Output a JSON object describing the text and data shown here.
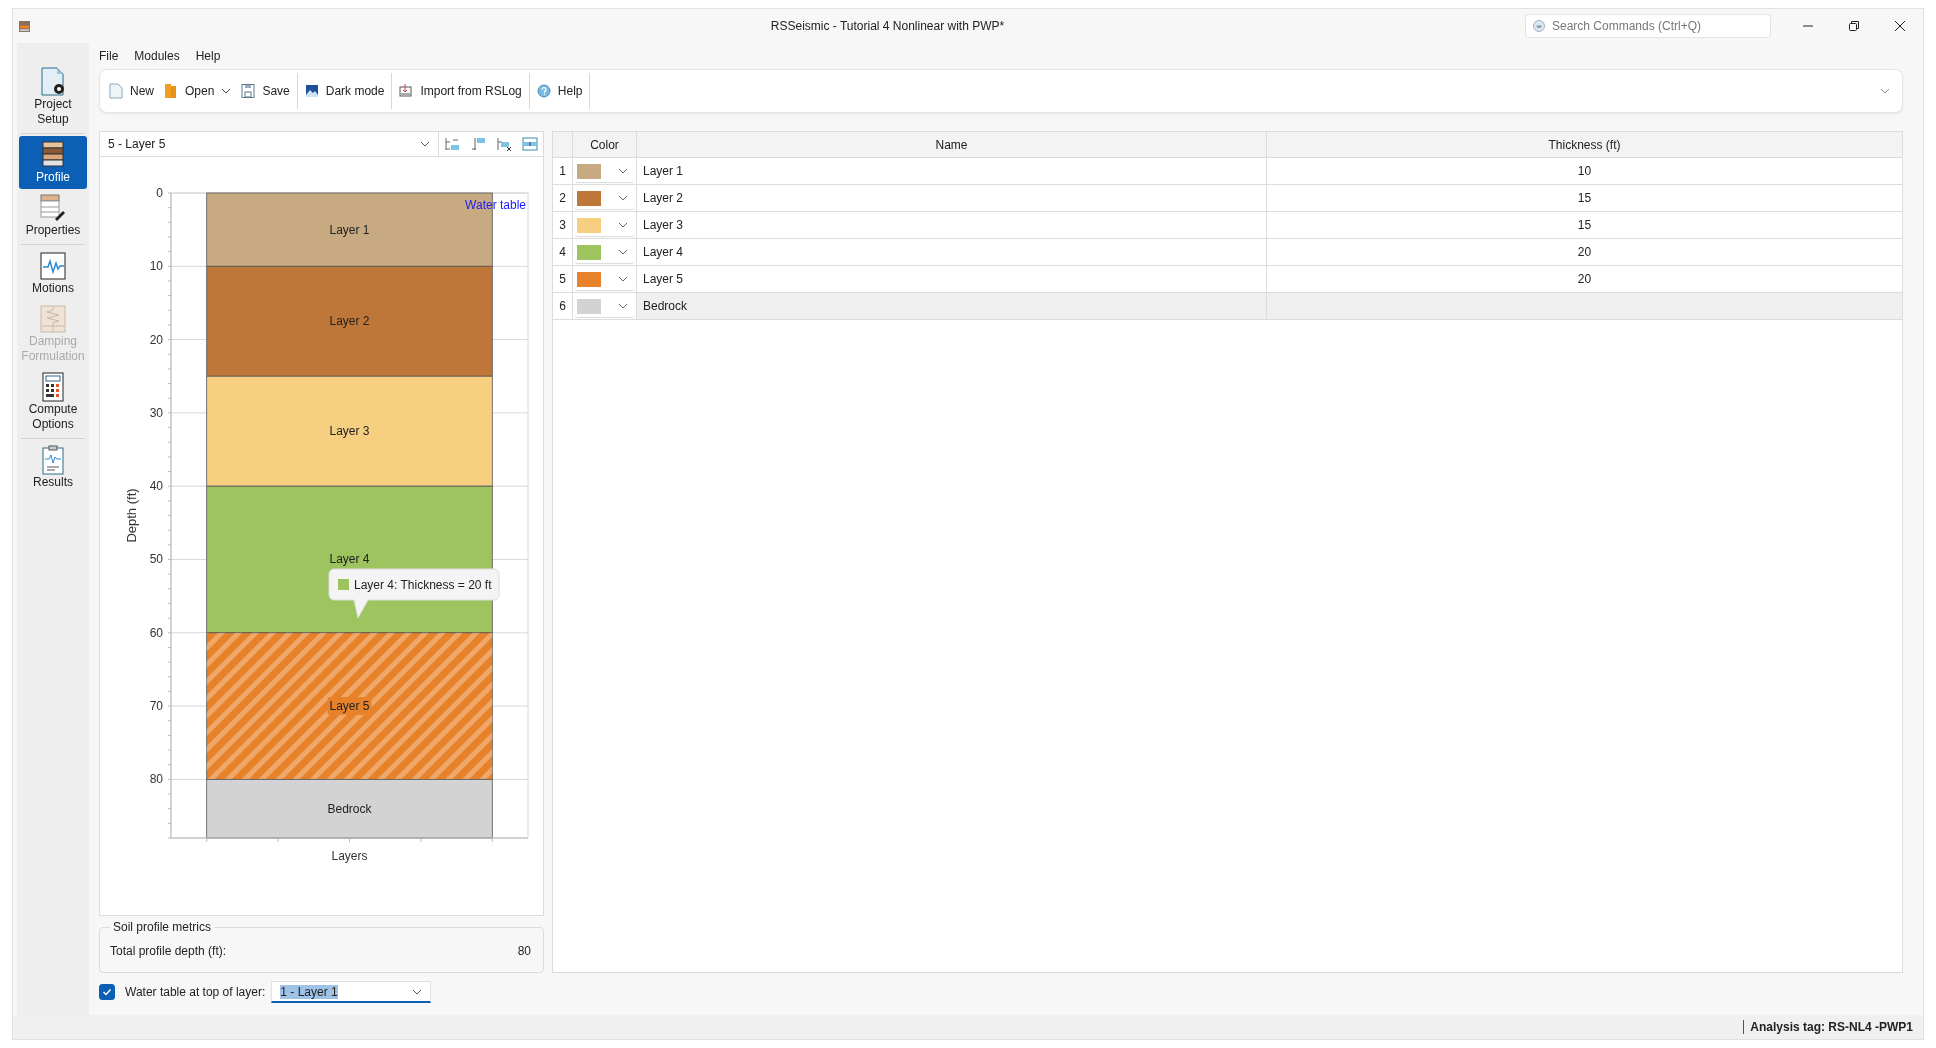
{
  "window": {
    "title": "RSSeismic - Tutorial 4 Nonlinear with PWP*",
    "search": {
      "placeholder": "Search Commands (Ctrl+Q)"
    }
  },
  "menu": [
    "File",
    "Modules",
    "Help"
  ],
  "toolbar": [
    {
      "kind": "button",
      "label": "New",
      "dropdown": false
    },
    {
      "kind": "button",
      "label": "Open",
      "dropdown": true
    },
    {
      "kind": "button",
      "label": "Save",
      "dropdown": false
    },
    {
      "kind": "separator"
    },
    {
      "kind": "button",
      "label": "Dark mode",
      "dropdown": false
    },
    {
      "kind": "separator"
    },
    {
      "kind": "button",
      "label": "Import from RSLog",
      "dropdown": false
    },
    {
      "kind": "separator"
    },
    {
      "kind": "button",
      "label": "Help",
      "dropdown": false
    },
    {
      "kind": "separator"
    }
  ],
  "sidebar": {
    "items": [
      {
        "kind": "item",
        "label": "Project Setup",
        "selected": false,
        "disabled": false
      },
      {
        "kind": "separator"
      },
      {
        "kind": "item",
        "label": "Profile",
        "selected": true,
        "disabled": false
      },
      {
        "kind": "item",
        "label": "Properties",
        "selected": false,
        "disabled": false
      },
      {
        "kind": "separator"
      },
      {
        "kind": "item",
        "label": "Motions",
        "selected": false,
        "disabled": false
      },
      {
        "kind": "item",
        "label": "Damping Formulation",
        "selected": false,
        "disabled": true
      },
      {
        "kind": "item",
        "label": "Compute Options",
        "selected": false,
        "disabled": false
      },
      {
        "kind": "separator"
      },
      {
        "kind": "item",
        "label": "Results",
        "selected": false,
        "disabled": false
      }
    ]
  },
  "layer_selector": {
    "value": "5 - Layer 5"
  },
  "profile_chart": {
    "chart_data": {
      "type": "bar",
      "stacked": true,
      "grid": true,
      "orientation": "vertical",
      "ylabel": "Depth (ft)",
      "categories": [
        "Layers"
      ],
      "ylim": [
        88,
        0
      ],
      "yticks": [
        0,
        10,
        20,
        30,
        40,
        50,
        60,
        70,
        80
      ],
      "series": [
        {
          "name": "Layer 1",
          "color": "#c8aa82",
          "values": [
            10
          ]
        },
        {
          "name": "Layer 2",
          "color": "#bf7739",
          "values": [
            15
          ]
        },
        {
          "name": "Layer 3",
          "color": "#f6d080",
          "values": [
            15
          ]
        },
        {
          "name": "Layer 4",
          "color": "#9dc45f",
          "values": [
            20
          ]
        },
        {
          "name": "Layer 5",
          "color": "#e8822a",
          "values": [
            20
          ]
        },
        {
          "name": "Bedrock",
          "color": "#d3d3d3",
          "values": [
            8
          ]
        }
      ],
      "annotations": [
        {
          "text": "Water table"
        }
      ]
    },
    "bars": [
      {
        "selected": false
      },
      {
        "selected": false
      },
      {
        "selected": false
      },
      {
        "selected": false
      },
      {
        "selected": true
      },
      {
        "selected": false
      }
    ],
    "tooltip": {
      "text": "Layer 4: Thickness = 20 ft",
      "color": "#9dc45f"
    }
  },
  "metrics": {
    "title": "Soil profile metrics",
    "rows": [
      {
        "label": "Total profile depth (ft):",
        "value": "80"
      }
    ]
  },
  "water_table": {
    "checked": true,
    "label": "Water table at top of layer:",
    "value": "1 - Layer 1"
  },
  "table": {
    "columns": [
      "Color",
      "Name",
      "Thickness (ft)"
    ],
    "rows": [
      {
        "index": "1",
        "color": "#c8aa82",
        "name": "Layer 1",
        "thickness": "10",
        "readonly": false
      },
      {
        "index": "2",
        "color": "#bf7739",
        "name": "Layer 2",
        "thickness": "15",
        "readonly": false
      },
      {
        "index": "3",
        "color": "#f6d080",
        "name": "Layer 3",
        "thickness": "15",
        "readonly": false
      },
      {
        "index": "4",
        "color": "#9dc45f",
        "name": "Layer 4",
        "thickness": "20",
        "readonly": false
      },
      {
        "index": "5",
        "color": "#e8822a",
        "name": "Layer 5",
        "thickness": "20",
        "readonly": false
      },
      {
        "index": "6",
        "color": "#d3d3d3",
        "name": "Bedrock",
        "readonly": true
      }
    ]
  },
  "status_bar": {
    "analysis_tag": "Analysis tag: RS-NL4 -PWP1"
  }
}
